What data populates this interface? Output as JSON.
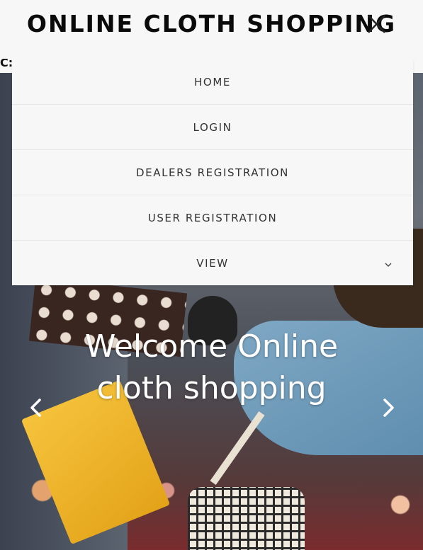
{
  "header": {
    "brand": "ONLINE CLOTH SHOPPING",
    "toggle_icon": "close-icon"
  },
  "sliver_label": "C:",
  "nav": {
    "items": [
      {
        "label": "HOME"
      },
      {
        "label": "LOGIN"
      },
      {
        "label": "DEALERS REGISTRATION"
      },
      {
        "label": "USER REGISTRATION"
      },
      {
        "label": "VIEW",
        "icon": "chevron-down-icon"
      }
    ]
  },
  "hero": {
    "caption_line1": "Welcome Online",
    "caption_line2": "cloth shopping",
    "prev_icon": "chevron-left-icon",
    "next_icon": "chevron-right-icon"
  },
  "colors": {
    "header_bg": "#f7f7f7",
    "menu_text": "#333333",
    "caption_text": "#ffffff",
    "brand_text": "#0a0a0a"
  }
}
